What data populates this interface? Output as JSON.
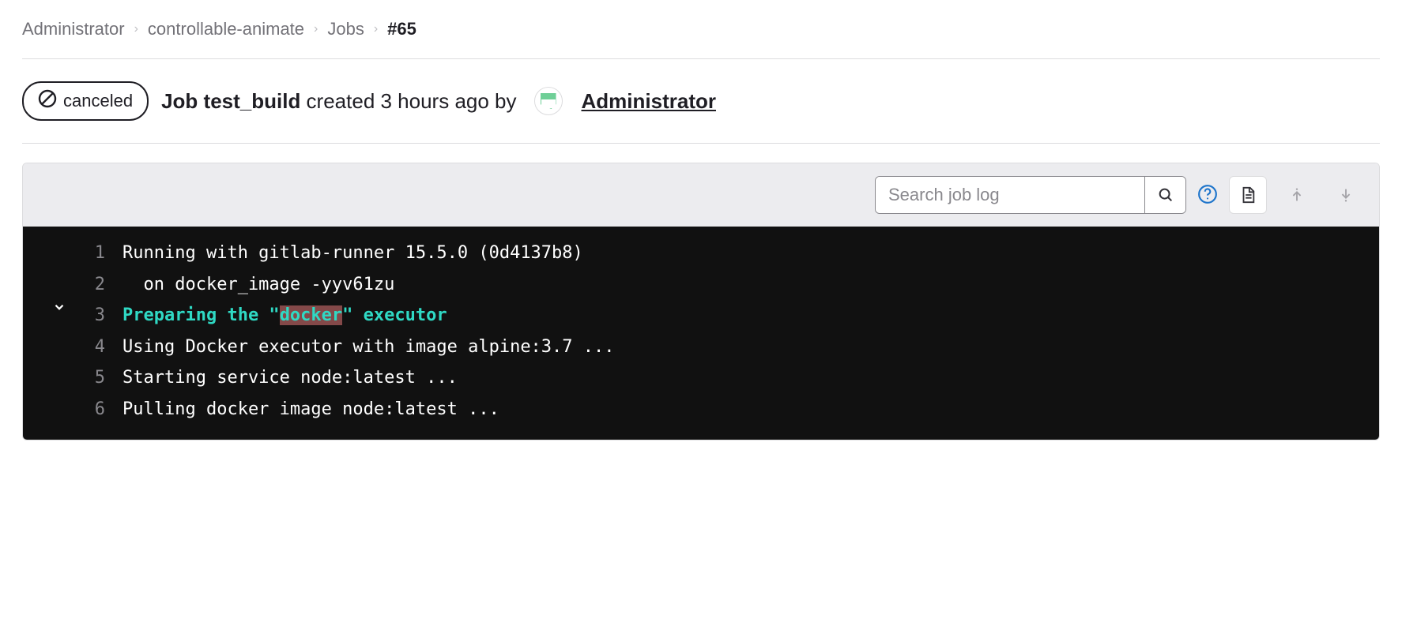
{
  "breadcrumb": {
    "items": [
      "Administrator",
      "controllable-animate",
      "Jobs"
    ],
    "current": "#65"
  },
  "job": {
    "status": "canceled",
    "title_prefix": "Job ",
    "job_name": "test_build",
    "created_text": " created 3 hours ago by",
    "author": "Administrator"
  },
  "toolbar": {
    "search_placeholder": "Search job log"
  },
  "log": {
    "lines": [
      {
        "n": "1",
        "type": "plain",
        "text": "Running with gitlab-runner 15.5.0 (0d4137b8)"
      },
      {
        "n": "2",
        "type": "plain",
        "text": "  on docker_image -yyv61zu"
      },
      {
        "n": "3",
        "type": "section",
        "pre": "Preparing the \"",
        "hl": "docker",
        "post": "\" executor"
      },
      {
        "n": "4",
        "type": "plain",
        "text": "Using Docker executor with image alpine:3.7 ..."
      },
      {
        "n": "5",
        "type": "plain",
        "text": "Starting service node:latest ..."
      },
      {
        "n": "6",
        "type": "plain",
        "text": "Pulling docker image node:latest ..."
      }
    ]
  }
}
